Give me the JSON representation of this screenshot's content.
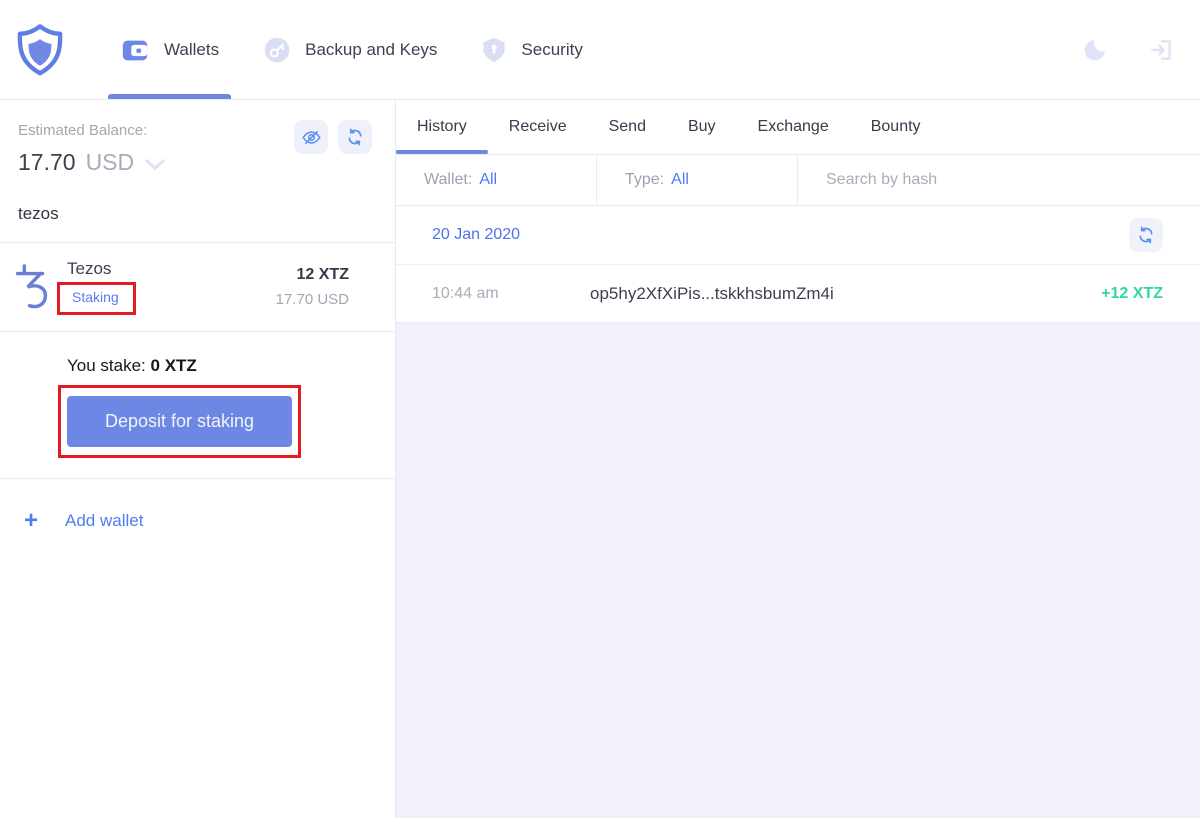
{
  "header": {
    "nav": [
      {
        "label": "Wallets",
        "active": true
      },
      {
        "label": "Backup and Keys",
        "active": false
      },
      {
        "label": "Security",
        "active": false
      }
    ]
  },
  "sidebar": {
    "balance": {
      "label": "Estimated Balance:",
      "amount": "17.70",
      "currency": "USD"
    },
    "search_value": "tezos",
    "wallet": {
      "name": "Tezos",
      "staking_label": "Staking",
      "amount_crypto": "12 XTZ",
      "amount_fiat": "17.70 USD"
    },
    "staking": {
      "you_stake_label": "You stake:",
      "you_stake_value": "0 XTZ",
      "deposit_button": "Deposit for staking"
    },
    "add_wallet": {
      "plus": "+",
      "label": "Add wallet"
    }
  },
  "main": {
    "tabs": [
      {
        "label": "History",
        "active": true
      },
      {
        "label": "Receive",
        "active": false
      },
      {
        "label": "Send",
        "active": false
      },
      {
        "label": "Buy",
        "active": false
      },
      {
        "label": "Exchange",
        "active": false
      },
      {
        "label": "Bounty",
        "active": false
      }
    ],
    "filters": {
      "wallet_label": "Wallet:",
      "wallet_value": "All",
      "type_label": "Type:",
      "type_value": "All",
      "search_placeholder": "Search by hash"
    },
    "history": {
      "date": "20 Jan 2020",
      "transactions": [
        {
          "time": "10:44 am",
          "hash": "op5hy2XfXiPis...tskkhsbumZm4i",
          "amount": "+12 XTZ"
        }
      ]
    }
  },
  "colors": {
    "accent": "#6d87e4",
    "link_blue": "#4d7df2",
    "positive_green": "#2fd7a6",
    "annotation_red": "#e11b22",
    "muted_gray": "#a3a7b3",
    "panel_bg": "#f0f1fa"
  }
}
